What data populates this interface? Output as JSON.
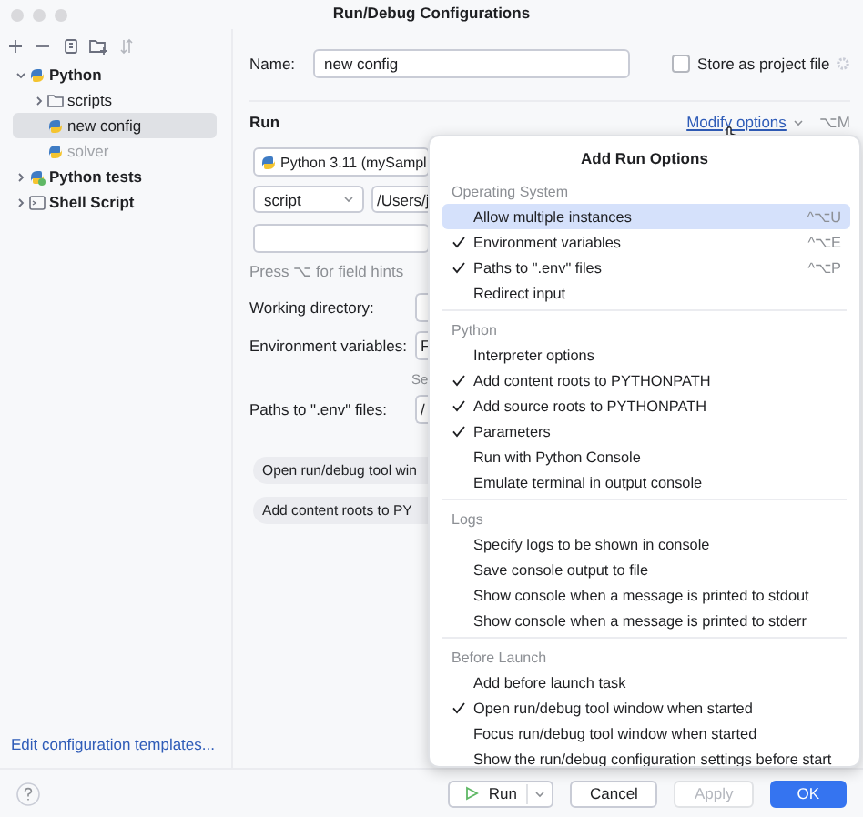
{
  "window": {
    "title": "Run/Debug Configurations"
  },
  "tree": [
    {
      "label": "Python",
      "kind": "python",
      "expanded": true,
      "selected": false,
      "dimmed": false,
      "children": [
        {
          "label": "scripts",
          "kind": "folder",
          "expanded": false,
          "selected": false,
          "dimmed": false
        },
        {
          "label": "new config",
          "kind": "python",
          "selected": true,
          "dimmed": false
        },
        {
          "label": "solver",
          "kind": "python",
          "selected": false,
          "dimmed": true
        }
      ]
    },
    {
      "label": "Python tests",
      "kind": "python-tests",
      "expanded": false,
      "selected": false,
      "dimmed": false
    },
    {
      "label": "Shell Script",
      "kind": "shell",
      "expanded": false,
      "selected": false,
      "dimmed": false
    }
  ],
  "templates_link": "Edit configuration templates...",
  "form": {
    "name_label": "Name:",
    "name_value": "new config",
    "store_label": "Store as project file",
    "store_checked": false,
    "run_label": "Run",
    "modify_options": "Modify options",
    "modify_shortcut": "⌥M",
    "interpreter": "Python 3.11 (mySampl",
    "script_type": "script",
    "script_path": "/Users/j",
    "hint": "Press ⌥ for field hints",
    "fields": [
      {
        "label": "Working directory:"
      },
      {
        "label": "Environment variables:",
        "value": "F",
        "note": "Se"
      },
      {
        "label": "Paths to \".env\" files:",
        "value": "/"
      }
    ],
    "chips": [
      "Open run/debug tool win",
      "Add content roots to PY"
    ]
  },
  "popup": {
    "title": "Add Run Options",
    "sections": [
      {
        "title": "Operating System",
        "items": [
          {
            "label": "Allow multiple instances",
            "checked": false,
            "selected": true,
            "shortcut": "^⌥U"
          },
          {
            "label": "Environment variables",
            "checked": true,
            "selected": false,
            "shortcut": "^⌥E"
          },
          {
            "label": "Paths to \".env\" files",
            "checked": true,
            "selected": false,
            "shortcut": "^⌥P"
          },
          {
            "label": "Redirect input",
            "checked": false,
            "selected": false
          }
        ]
      },
      {
        "title": "Python",
        "items": [
          {
            "label": "Interpreter options",
            "checked": false,
            "selected": false
          },
          {
            "label": "Add content roots to PYTHONPATH",
            "checked": true,
            "selected": false
          },
          {
            "label": "Add source roots to PYTHONPATH",
            "checked": true,
            "selected": false
          },
          {
            "label": "Parameters",
            "checked": true,
            "selected": false
          },
          {
            "label": "Run with Python Console",
            "checked": false,
            "selected": false
          },
          {
            "label": "Emulate terminal in output console",
            "checked": false,
            "selected": false
          }
        ]
      },
      {
        "title": "Logs",
        "items": [
          {
            "label": "Specify logs to be shown in console",
            "checked": false,
            "selected": false
          },
          {
            "label": "Save console output to file",
            "checked": false,
            "selected": false
          },
          {
            "label": "Show console when a message is printed to stdout",
            "checked": false,
            "selected": false
          },
          {
            "label": "Show console when a message is printed to stderr",
            "checked": false,
            "selected": false
          }
        ]
      },
      {
        "title": "Before Launch",
        "items": [
          {
            "label": "Add before launch task",
            "checked": false,
            "selected": false
          },
          {
            "label": "Open run/debug tool window when started",
            "checked": true,
            "selected": false
          },
          {
            "label": "Focus run/debug tool window when started",
            "checked": false,
            "selected": false
          },
          {
            "label": "Show the run/debug configuration settings before start",
            "checked": false,
            "selected": false
          }
        ]
      }
    ]
  },
  "buttons": [
    {
      "label": "Run",
      "kind": "split",
      "disabled": false
    },
    {
      "label": "Cancel",
      "kind": "normal",
      "disabled": false
    },
    {
      "label": "Apply",
      "kind": "normal",
      "disabled": true
    },
    {
      "label": "OK",
      "kind": "primary",
      "disabled": false
    }
  ]
}
